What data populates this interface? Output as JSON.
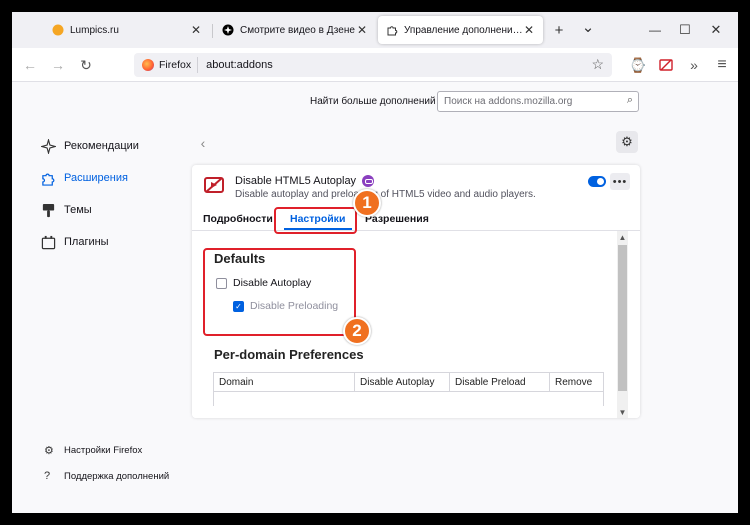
{
  "browser": {
    "tabs": [
      {
        "label": "Lumpics.ru",
        "close": "✕"
      },
      {
        "label": "Смотрите видео в Дзене",
        "close": "✕"
      },
      {
        "label": "Управление дополнениями",
        "close": "✕"
      }
    ],
    "new_tab": "+",
    "tab_list": "⌄",
    "window": {
      "minimize": "—",
      "maximize": "☐",
      "close": "✕"
    },
    "nav": {
      "back": "←",
      "forward": "→",
      "reload": "↻"
    },
    "identity": "Firefox",
    "url": "about:addons",
    "bookmark_star": "☆",
    "toolbar": {
      "history": "⌚",
      "overflow": "»",
      "menu": "≡"
    }
  },
  "addons_page": {
    "search_label": "Найти больше дополнений",
    "search_placeholder": "Поиск на addons.mozilla.org",
    "sidebar": [
      {
        "label": "Рекомендации",
        "icon": "sparkle-icon",
        "selected": false
      },
      {
        "label": "Расширения",
        "icon": "puzzle-icon",
        "selected": true
      },
      {
        "label": "Темы",
        "icon": "brush-icon",
        "selected": false
      },
      {
        "label": "Плагины",
        "icon": "plugin-icon",
        "selected": false
      }
    ],
    "footer": [
      {
        "label": "Настройки Firefox",
        "icon": "gear-icon"
      },
      {
        "label": "Поддержка дополнений",
        "icon": "help-icon"
      }
    ],
    "addon": {
      "name": "Disable HTML5 Autoplay",
      "description": "Disable autoplay and preloading of HTML5 video and audio players.",
      "enabled": true,
      "more": "•••"
    },
    "detail_tabs": [
      {
        "label": "Подробности",
        "active": false
      },
      {
        "label": "Настройки",
        "active": true
      },
      {
        "label": "Разрешения",
        "active": false
      }
    ],
    "settings": {
      "defaults_heading": "Defaults",
      "options": [
        {
          "label": "Disable Autoplay",
          "checked": false,
          "disabled": false
        },
        {
          "label": "Disable Preloading",
          "checked": true,
          "disabled": true
        }
      ],
      "per_domain_heading": "Per-domain Preferences",
      "table_headers": [
        "Domain",
        "Disable Autoplay",
        "Disable Preload",
        "Remove"
      ]
    }
  },
  "annotations": {
    "marker_1": "1",
    "marker_2": "2",
    "color": "#e0202a",
    "marker_color": "#f07020"
  }
}
